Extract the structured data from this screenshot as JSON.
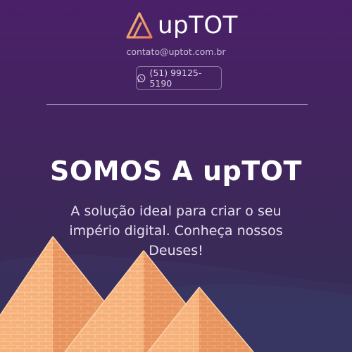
{
  "brand": {
    "name": "upTOT",
    "logo_icon": "triangle-logo-icon"
  },
  "contact": {
    "email": "contato@uptot.com.br",
    "phone": "(51) 99125-5190",
    "phone_icon": "whatsapp-icon"
  },
  "hero": {
    "title": "SOMOS A upTOT",
    "subtitle": "A solução ideal para criar o seu império digital. Conheça nossos Deuses!"
  },
  "colors": {
    "background_top": "#4a2068",
    "background_bottom": "#2f2e54",
    "logo_gradient_start": "#f2c27a",
    "logo_gradient_end": "#e8785a",
    "pyramid_light": "#f6b07a",
    "pyramid_shadow": "#e08d5c"
  }
}
